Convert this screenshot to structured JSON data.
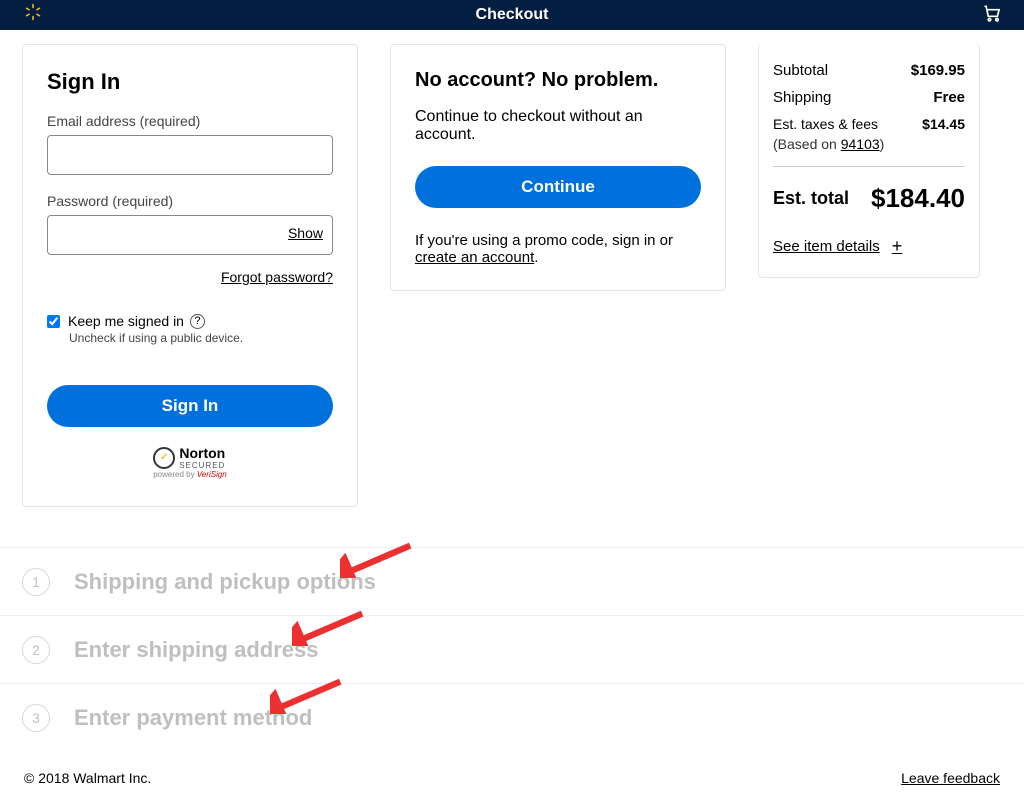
{
  "header": {
    "title": "Checkout"
  },
  "signin": {
    "heading": "Sign In",
    "email_label": "Email address (required)",
    "password_label": "Password (required)",
    "show_label": "Show",
    "forgot_label": "Forgot password?",
    "keep_label": "Keep me signed in",
    "keep_note": "Uncheck if using a public device.",
    "button_label": "Sign In",
    "norton_name": "Norton",
    "norton_secured": "SECURED",
    "norton_powered": "powered by",
    "norton_verisign": "VeriSign"
  },
  "guest": {
    "heading": "No account? No problem.",
    "subtext": "Continue to checkout without an account.",
    "button_label": "Continue",
    "promo_prefix": "If you're using a promo code, sign in or ",
    "promo_link": "create an account",
    "promo_suffix": "."
  },
  "summary": {
    "subtotal_label": "Subtotal",
    "subtotal_value": "$169.95",
    "shipping_label": "Shipping",
    "shipping_value": "Free",
    "tax_label": "Est. taxes & fees",
    "tax_value": "$14.45",
    "based_prefix": "(Based on ",
    "based_zip": "94103",
    "based_suffix": ")",
    "total_label": "Est. total",
    "total_value": "$184.40",
    "see_items": "See item details"
  },
  "steps": [
    {
      "num": "1",
      "label": "Shipping and pickup options"
    },
    {
      "num": "2",
      "label": "Enter shipping address"
    },
    {
      "num": "3",
      "label": "Enter payment method"
    }
  ],
  "footer": {
    "copyright": "© 2018 Walmart Inc.",
    "feedback": "Leave feedback"
  }
}
